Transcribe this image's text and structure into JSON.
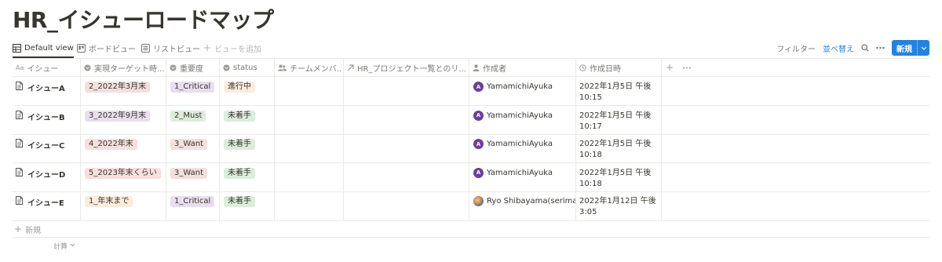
{
  "page": {
    "title": "HR_イシューロードマップ"
  },
  "views": {
    "tabs": [
      {
        "label": "Default view",
        "icon": "table-icon"
      },
      {
        "label": "ボードビュー",
        "icon": "board-icon"
      },
      {
        "label": "リストビュー",
        "icon": "list-icon"
      }
    ],
    "add_view_label": "ビューを追加"
  },
  "toolbar": {
    "filter_label": "フィルター",
    "sort_label": "並べ替え",
    "new_label": "新規"
  },
  "colors": {
    "accent": "#2383e2",
    "text": "#37352f",
    "muted": "#787774"
  },
  "table": {
    "columns": [
      {
        "label": "イシュー",
        "icon": "text-type-icon"
      },
      {
        "label": "実現ターゲット時...",
        "icon": "select-icon"
      },
      {
        "label": "重要度",
        "icon": "select-icon"
      },
      {
        "label": "status",
        "icon": "select-icon"
      },
      {
        "label": "チームメンバ...",
        "icon": "people-icon"
      },
      {
        "label": "HR_プロジェクト一覧とのリ...",
        "icon": "relation-arrow-icon"
      },
      {
        "label": "作成者",
        "icon": "person-icon"
      },
      {
        "label": "作成日時",
        "icon": "clock-icon"
      }
    ],
    "rows": [
      {
        "name": "イシューA",
        "target": "2_2022年3月末",
        "target_color": "#f1e0dd",
        "priority": "1_Critical",
        "priority_color": "#e8deee",
        "status": "進行中",
        "status_color": "#fbecdd",
        "creator": "YamamichiAyuka",
        "avatar_letter": "A",
        "avatar_color": "#6b3fa0",
        "created_line1": "2022年1月5日 午後",
        "created_line2": "10:15"
      },
      {
        "name": "イシューB",
        "target": "3_2022年9月末",
        "target_color": "#e8deee",
        "priority": "2_Must",
        "priority_color": "#dbeddb",
        "status": "未着手",
        "status_color": "#dbeddb",
        "creator": "YamamichiAyuka",
        "avatar_letter": "A",
        "avatar_color": "#6b3fa0",
        "created_line1": "2022年1月5日 午後",
        "created_line2": "10:17"
      },
      {
        "name": "イシューC",
        "target": "4_2022年末",
        "target_color": "#f6dfde",
        "priority": "3_Want",
        "priority_color": "#f1e0dd",
        "status": "未着手",
        "status_color": "#dbeddb",
        "creator": "YamamichiAyuka",
        "avatar_letter": "A",
        "avatar_color": "#6b3fa0",
        "created_line1": "2022年1月5日 午後",
        "created_line2": "10:18"
      },
      {
        "name": "イシューD",
        "target": "5_2023年末くらい",
        "target_color": "#f6dfde",
        "priority": "3_Want",
        "priority_color": "#f1e0dd",
        "status": "未着手",
        "status_color": "#dbeddb",
        "creator": "YamamichiAyuka",
        "avatar_letter": "A",
        "avatar_color": "#6b3fa0",
        "created_line1": "2022年1月5日 午後",
        "created_line2": "10:18"
      },
      {
        "name": "イシューE",
        "target": "1_年末まで",
        "target_color": "#fbecdd",
        "priority": "1_Critical",
        "priority_color": "#e8deee",
        "status": "未着手",
        "status_color": "#dbeddb",
        "creator": "Ryo Shibayama(serima)",
        "avatar_letter": "",
        "avatar_color": "",
        "created_line1": "2022年1月12日 午後",
        "created_line2": "3:05"
      }
    ],
    "new_row_label": "新規",
    "calc_label": "計算"
  }
}
